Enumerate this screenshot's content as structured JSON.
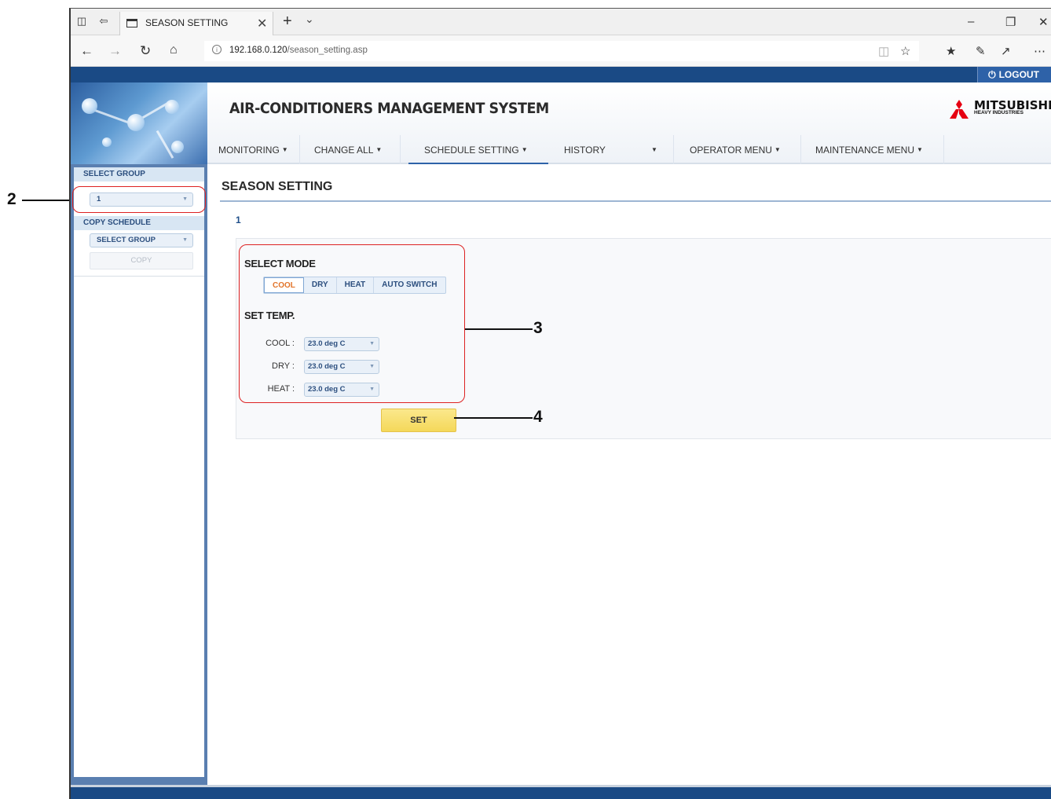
{
  "browser": {
    "tab_title": "SEASON SETTING",
    "url_host": "192.168.0.120",
    "url_path": "/season_setting.asp",
    "icons": {
      "tab_actions": "tab-actions-icon",
      "set_aside": "set-aside-tabs-icon",
      "page": "page-icon",
      "close": "close-icon",
      "new_tab": "plus-icon",
      "tabs_menu": "chevron-down-icon",
      "minimize": "minimize-icon",
      "restore": "restore-icon",
      "close_window": "close-window-icon",
      "back": "back-arrow-icon",
      "forward": "forward-arrow-icon",
      "refresh": "refresh-icon",
      "home": "home-icon",
      "info": "info-icon",
      "reading_view": "reading-view-icon",
      "favorite": "star-icon",
      "favorites_hub": "favorites-icon",
      "pen": "pen-icon",
      "share": "share-icon",
      "more": "more-icon"
    }
  },
  "app": {
    "logout_label": "LOGOUT",
    "system_title": "AIR-CONDITIONERS MANAGEMENT SYSTEM",
    "brand_name": "MITSUBISHI",
    "brand_sub": "HEAVY INDUSTRIES",
    "brand_color": "#e60012",
    "accent_color": "#2e62a8",
    "menu": [
      {
        "label": "MONITORING",
        "caret": true
      },
      {
        "label": "CHANGE ALL",
        "caret": true
      },
      {
        "label": "SCHEDULE SETTING",
        "caret": true,
        "active": true
      },
      {
        "label": "HISTORY",
        "caret": false
      },
      {
        "label": "",
        "caret": true
      },
      {
        "label": "OPERATOR MENU",
        "caret": true
      },
      {
        "label": "MAINTENANCE MENU",
        "caret": true
      }
    ]
  },
  "sidebar": {
    "select_group_label": "SELECT GROUP",
    "group_value": "1",
    "copy_schedule_label": "COPY SCHEDULE",
    "copy_select_value": "SELECT GROUP",
    "copy_button_label": "COPY"
  },
  "main": {
    "page_title": "SEASON SETTING",
    "group_name": "1",
    "select_mode_label": "SELECT MODE",
    "modes": [
      "COOL",
      "DRY",
      "HEAT",
      "AUTO SWITCH"
    ],
    "selected_mode": "COOL",
    "set_temp_label": "SET TEMP.",
    "temps": [
      {
        "label": "COOL :",
        "value": "23.0  deg C"
      },
      {
        "label": "DRY :",
        "value": "23.0  deg C"
      },
      {
        "label": "HEAT :",
        "value": "23.0  deg C"
      }
    ],
    "set_button_label": "SET"
  },
  "annotations": [
    "2",
    "3",
    "4"
  ]
}
